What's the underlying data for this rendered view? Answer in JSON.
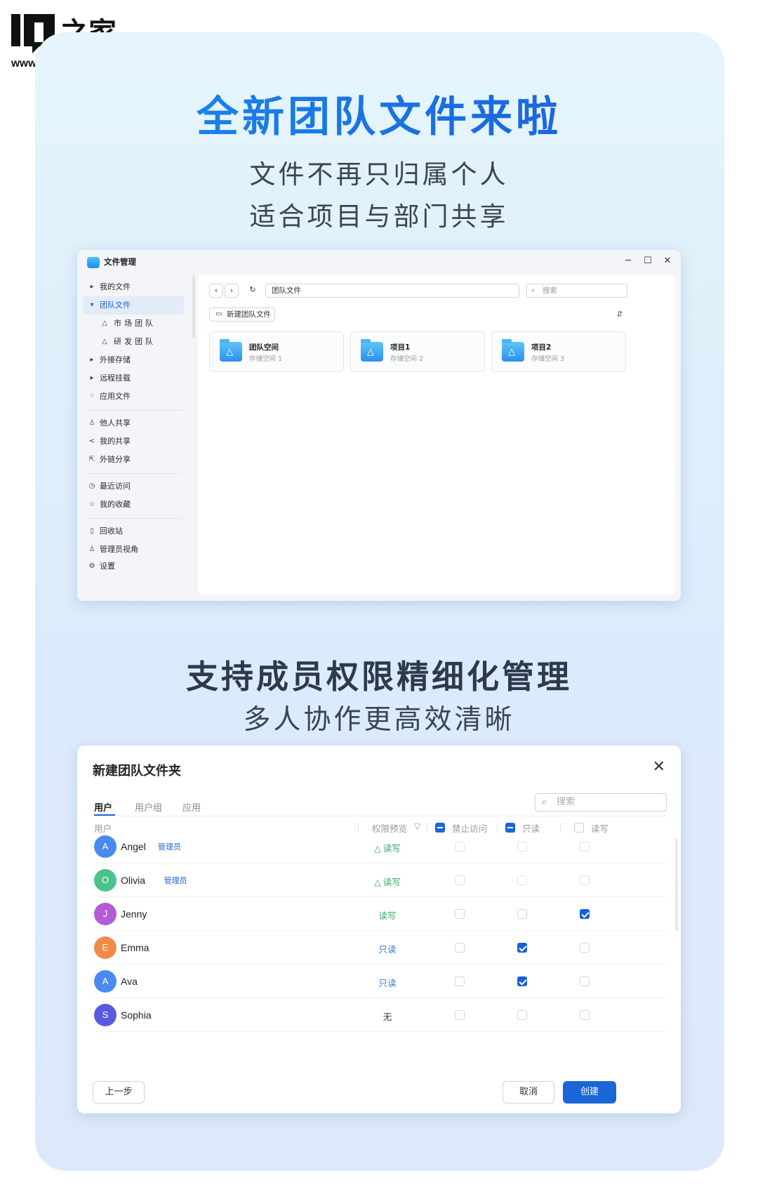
{
  "watermark": {
    "brand": "IT之家",
    "url": "www.ithome.com"
  },
  "poster": {
    "headline1": "全新团队文件来啦",
    "sub1": "文件不再只归属个人",
    "sub2": "适合项目与部门共享",
    "headline2": "支持成员权限精细化管理",
    "sub3": "多人协作更高效清晰"
  },
  "window": {
    "title": "文件管理",
    "controls": {
      "minimize": "─",
      "maximize": "☐",
      "close": "✕"
    },
    "sidebar": [
      {
        "label": "我的文件",
        "icon": "caret-right-icon"
      },
      {
        "label": "团队文件",
        "icon": "caret-down-icon",
        "active": true
      },
      {
        "label": "市场团队",
        "icon": "team-icon",
        "sub": true
      },
      {
        "label": "研发团队",
        "icon": "team-icon",
        "sub": true
      },
      {
        "label": "外接存储",
        "icon": "caret-right-icon"
      },
      {
        "label": "远程挂载",
        "icon": "caret-right-icon"
      },
      {
        "label": "应用文件",
        "icon": "apps-icon"
      },
      {
        "label": "他人共享",
        "icon": "user-share-icon"
      },
      {
        "label": "我的共享",
        "icon": "share-icon"
      },
      {
        "label": "外链分享",
        "icon": "external-link-icon"
      },
      {
        "label": "最近访问",
        "icon": "clock-icon"
      },
      {
        "label": "我的收藏",
        "icon": "star-icon"
      },
      {
        "label": "回收站",
        "icon": "trash-icon"
      },
      {
        "label": "管理员视角",
        "icon": "admin-icon"
      },
      {
        "label": "设置",
        "icon": "gear-icon"
      }
    ],
    "toolbar": {
      "back": "‹",
      "forward": "›",
      "refresh": "↻",
      "path": "团队文件",
      "search_placeholder": "搜索",
      "new_button": "新建团队文件",
      "sort": "⇵"
    },
    "cards": [
      {
        "name": "团队空间",
        "storage": "存储空间 1"
      },
      {
        "name": "项目1",
        "storage": "存储空间 2"
      },
      {
        "name": "项目2",
        "storage": "存储空间 3"
      }
    ]
  },
  "dialog": {
    "title": "新建团队文件夹",
    "close": "✕",
    "tabs": [
      "用户",
      "用户组",
      "应用"
    ],
    "search_placeholder": "搜索",
    "headers": {
      "user": "用户",
      "preview": "权限预览",
      "deny": "禁止访问",
      "read": "只读",
      "readwrite": "读写"
    },
    "header_checks": {
      "deny": "indeterminate",
      "read": "indeterminate",
      "readwrite": "unchecked"
    },
    "rows": [
      {
        "initial": "A",
        "name": "Angel",
        "badge": "管理员",
        "color": "#4a8af0",
        "perm": "读写",
        "perm_color": "#3aa86b",
        "perm_icon": "△",
        "deny": false,
        "read": false,
        "rw": false,
        "locked": true
      },
      {
        "initial": "O",
        "name": "Olivia",
        "badge": "管理员",
        "color": "#4cc38a",
        "perm": "读写",
        "perm_color": "#3aa86b",
        "perm_icon": "△",
        "deny": false,
        "read": false,
        "rw": false,
        "locked": true
      },
      {
        "initial": "J",
        "name": "Jenny",
        "badge": "",
        "color": "#b35bd6",
        "perm": "读写",
        "perm_color": "#3aa86b",
        "perm_icon": "",
        "deny": false,
        "read": false,
        "rw": true,
        "locked": false
      },
      {
        "initial": "E",
        "name": "Emma",
        "badge": "",
        "color": "#f08a4b",
        "perm": "只读",
        "perm_color": "#2a7be0",
        "perm_icon": "",
        "deny": false,
        "read": true,
        "rw": false,
        "locked": false
      },
      {
        "initial": "A",
        "name": "Ava",
        "badge": "",
        "color": "#4a8af0",
        "perm": "只读",
        "perm_color": "#2a7be0",
        "perm_icon": "",
        "deny": false,
        "read": true,
        "rw": false,
        "locked": false
      },
      {
        "initial": "S",
        "name": "Sophia",
        "badge": "",
        "color": "#5a5ae0",
        "perm": "无",
        "perm_color": "#333333",
        "perm_icon": "",
        "deny": false,
        "read": false,
        "rw": false,
        "locked": false
      }
    ],
    "buttons": {
      "prev": "上一步",
      "cancel": "取消",
      "create": "创建"
    }
  }
}
